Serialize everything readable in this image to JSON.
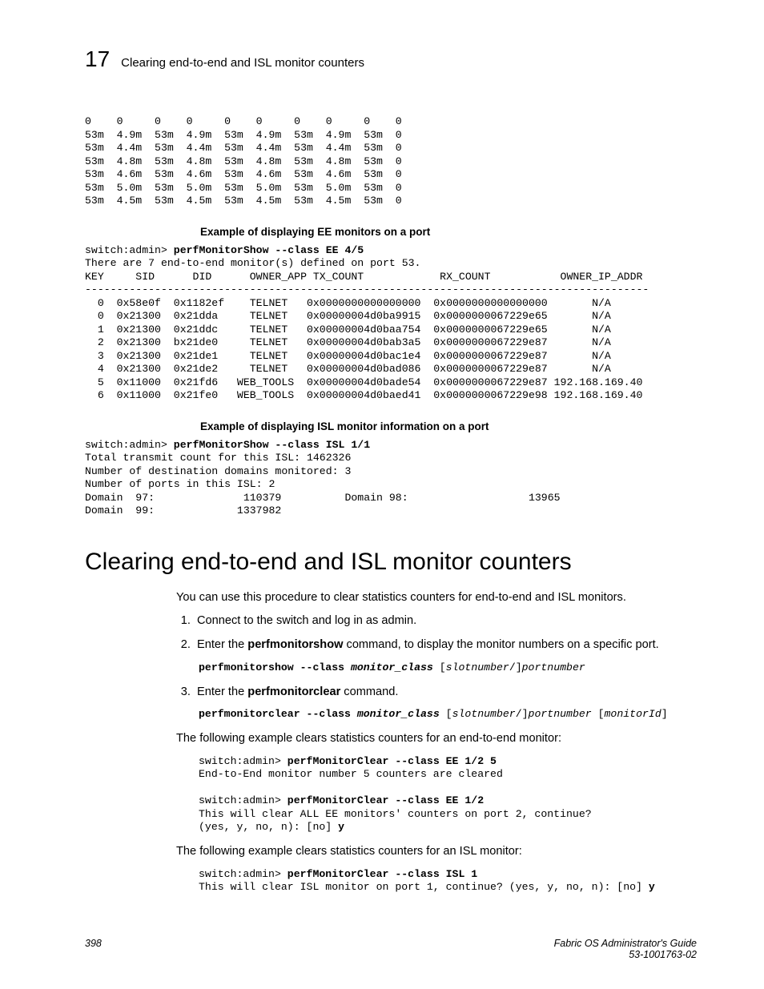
{
  "header": {
    "chapter_num": "17",
    "title": "Clearing end-to-end and ISL monitor counters"
  },
  "top_table": "0    0     0    0     0    0     0    0     0    0\n53m  4.9m  53m  4.9m  53m  4.9m  53m  4.9m  53m  0\n53m  4.4m  53m  4.4m  53m  4.4m  53m  4.4m  53m  0\n53m  4.8m  53m  4.8m  53m  4.8m  53m  4.8m  53m  0\n53m  4.6m  53m  4.6m  53m  4.6m  53m  4.6m  53m  0\n53m  5.0m  53m  5.0m  53m  5.0m  53m  5.0m  53m  0\n53m  4.5m  53m  4.5m  53m  4.5m  53m  4.5m  53m  0",
  "ee_caption": "Example of displaying EE monitors on a port",
  "ee_block": {
    "prompt": "switch:admin> ",
    "cmd": "perfMonitorShow --class EE 4/5",
    "body": "There are 7 end-to-end monitor(s) defined on port 53.\nKEY     SID      DID      OWNER_APP TX_COUNT            RX_COUNT           OWNER_IP_ADDR\n-----------------------------------------------------------------------------------------\n  0  0x58e0f  0x1182ef    TELNET   0x0000000000000000  0x0000000000000000       N/A\n  0  0x21300  0x21dda     TELNET   0x00000004d0ba9915  0x0000000067229e65       N/A\n  1  0x21300  0x21ddc     TELNET   0x00000004d0baa754  0x0000000067229e65       N/A\n  2  0x21300  bx21de0     TELNET   0x00000004d0bab3a5  0x0000000067229e87       N/A\n  3  0x21300  0x21de1     TELNET   0x00000004d0bac1e4  0x0000000067229e87       N/A\n  4  0x21300  0x21de2     TELNET   0x00000004d0bad086  0x0000000067229e87       N/A\n  5  0x11000  0x21fd6   WEB_TOOLS  0x00000004d0bade54  0x0000000067229e87 192.168.169.40\n  6  0x11000  0x21fe0   WEB_TOOLS  0x00000004d0baed41  0x0000000067229e98 192.168.169.40"
  },
  "isl_caption": "Example of displaying ISL monitor information on a port",
  "isl_block": {
    "prompt": "switch:admin> ",
    "cmd": "perfMonitorShow --class ISL 1/1",
    "body": "Total transmit count for this ISL: 1462326\nNumber of destination domains monitored: 3\nNumber of ports in this ISL: 2\nDomain  97:              110379          Domain 98:                   13965\nDomain  99:             1337982"
  },
  "section_heading": "Clearing end-to-end and ISL monitor counters",
  "intro": "You can use this procedure to clear statistics counters for end-to-end and ISL monitors.",
  "steps": {
    "s1": "Connect to the switch and log in as admin.",
    "s2a": "Enter the ",
    "s2b": "perfmonitorshow",
    "s2c": " command, to display the monitor numbers on a specific port.",
    "s2_code_cmd": "perfmonitorshow --class",
    "s2_code_arg1": "monitor_class",
    "s2_code_br1": " [",
    "s2_code_arg2": "slotnumber",
    "s2_code_br2": "/]",
    "s2_code_arg3": "portnumber",
    "s3a": "Enter the ",
    "s3b": "perfmonitorclear",
    "s3c": " command.",
    "s3_code_cmd": "perfmonitorclear --class",
    "s3_code_arg1": "monitor_class",
    "s3_code_br1": " [",
    "s3_code_arg2": "slotnumber",
    "s3_code_br2": "/]",
    "s3_code_arg3": "portnumber",
    "s3_code_br3": " [",
    "s3_code_arg4": "monitorId",
    "s3_code_br4": "]"
  },
  "ex1_intro": "The following example clears statistics counters for an end-to-end monitor:",
  "ex1": {
    "p1": "switch:admin> ",
    "c1": "perfMonitorClear --class EE 1/2 5",
    "l1": "End-to-End monitor number 5 counters are cleared",
    "p2": "switch:admin> ",
    "c2": "perfMonitorClear --class EE 1/2",
    "l2": "This will clear ALL EE monitors' counters on port 2, continue?",
    "l3": "(yes, y, no, n): [no] ",
    "y": "y"
  },
  "ex2_intro": "The following example clears statistics counters for an ISL monitor:",
  "ex2": {
    "p1": "switch:admin> ",
    "c1": "perfMonitorClear --class ISL 1",
    "l1": "This will clear ISL monitor on port 1, continue? (yes, y, no, n): [no] ",
    "y": "y"
  },
  "footer": {
    "page": "398",
    "doc": "Fabric OS Administrator's Guide",
    "num": "53-1001763-02"
  }
}
